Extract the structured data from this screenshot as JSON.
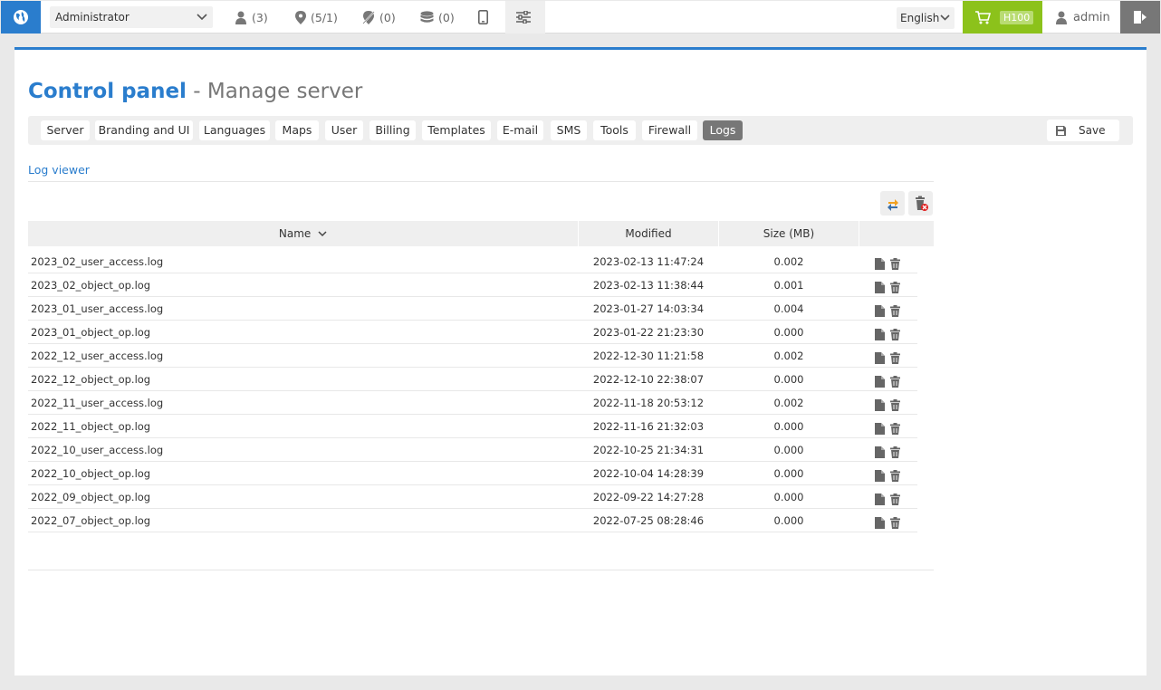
{
  "topbar": {
    "role": "Administrator",
    "stats": [
      {
        "icon": "user-icon",
        "text": "(3)"
      },
      {
        "icon": "map-pin-icon",
        "text": "(5/1)"
      },
      {
        "icon": "pin-off-icon",
        "text": "(0)"
      },
      {
        "icon": "coins-icon",
        "text": "(0)"
      }
    ],
    "language": "English",
    "cart_badge": "H100",
    "username": "admin"
  },
  "page": {
    "title": "Control panel",
    "subtitle": "- Manage server"
  },
  "tabs": [
    "Server",
    "Branding and UI",
    "Languages",
    "Maps",
    "User",
    "Billing",
    "Templates",
    "E-mail",
    "SMS",
    "Tools",
    "Firewall",
    "Logs"
  ],
  "active_tab": "Logs",
  "save_label": "Save",
  "section_label": "Log viewer",
  "table": {
    "headers": {
      "name": "Name",
      "modified": "Modified",
      "size": "Size (MB)"
    },
    "rows": [
      {
        "name": "2023_02_user_access.log",
        "modified": "2023-02-13 11:47:24",
        "size": "0.002"
      },
      {
        "name": "2023_02_object_op.log",
        "modified": "2023-02-13 11:38:44",
        "size": "0.001"
      },
      {
        "name": "2023_01_user_access.log",
        "modified": "2023-01-27 14:03:34",
        "size": "0.004"
      },
      {
        "name": "2023_01_object_op.log",
        "modified": "2023-01-22 21:23:30",
        "size": "0.000"
      },
      {
        "name": "2022_12_user_access.log",
        "modified": "2022-12-30 11:21:58",
        "size": "0.002"
      },
      {
        "name": "2022_12_object_op.log",
        "modified": "2022-12-10 22:38:07",
        "size": "0.000"
      },
      {
        "name": "2022_11_user_access.log",
        "modified": "2022-11-18 20:53:12",
        "size": "0.002"
      },
      {
        "name": "2022_11_object_op.log",
        "modified": "2022-11-16 21:32:03",
        "size": "0.000"
      },
      {
        "name": "2022_10_user_access.log",
        "modified": "2022-10-25 21:34:31",
        "size": "0.000"
      },
      {
        "name": "2022_10_object_op.log",
        "modified": "2022-10-04 14:28:39",
        "size": "0.000"
      },
      {
        "name": "2022_09_object_op.log",
        "modified": "2022-09-22 14:27:28",
        "size": "0.000"
      },
      {
        "name": "2022_07_object_op.log",
        "modified": "2022-07-25 08:28:46",
        "size": "0.000"
      }
    ]
  },
  "colors": {
    "brand": "#2a7dcd",
    "cart": "#8cc21b",
    "active_tab": "#777777"
  }
}
